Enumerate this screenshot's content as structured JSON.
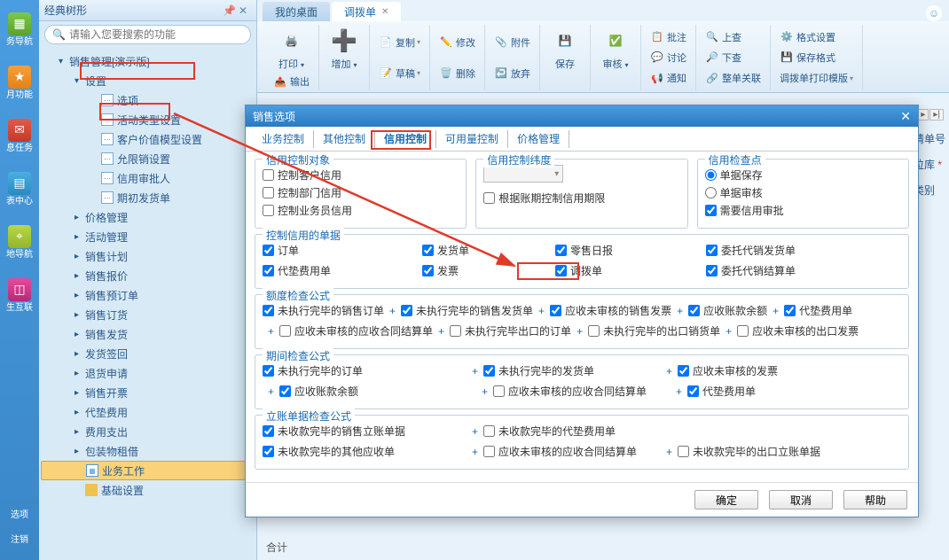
{
  "leftbar": {
    "items": [
      {
        "label": "务导航"
      },
      {
        "label": "月功能"
      },
      {
        "label": "息任务"
      },
      {
        "label": "表中心"
      },
      {
        "label": "地导航"
      },
      {
        "label": "生互联"
      }
    ],
    "bottom": [
      {
        "label": "选项"
      },
      {
        "label": "注销"
      }
    ]
  },
  "sidepanel": {
    "title": "经典树形",
    "search_placeholder": "请输入您要搜索的功能",
    "root": "销售管理[演示版]",
    "settings": "设置",
    "settings_children": [
      "选项",
      "活动类型设置",
      "客户价值模型设置",
      "允限销设置",
      "信用审批人",
      "期初发货单"
    ],
    "categories": [
      "价格管理",
      "活动管理",
      "销售计划",
      "销售报价",
      "销售预订单",
      "销售订货",
      "销售发货",
      "发货签回",
      "退货申请",
      "销售开票",
      "代垫费用",
      "费用支出",
      "包装物租借"
    ],
    "biz_work": "业务工作",
    "base_settings": "基础设置"
  },
  "tabs": {
    "desktop": "我的桌面",
    "active": "调拨单"
  },
  "toolbar": {
    "print": "打印",
    "output": "输出",
    "add": "增加",
    "copy": "复制",
    "draft": "草稿",
    "modify": "修改",
    "delete": "删除",
    "attach": "附件",
    "abandon": "放弃",
    "save": "保存",
    "audit": "审核",
    "batch_note": "批注",
    "discuss": "讨论",
    "notify": "通知",
    "up_check": "上查",
    "down_check": "下查",
    "doc_relation": "整单关联",
    "format": "格式设置",
    "save_format": "保存格式",
    "print_template": "调拨单打印模版"
  },
  "dialog": {
    "title": "销售选项",
    "tabs": [
      "业务控制",
      "其他控制",
      "信用控制",
      "可用量控制",
      "价格管理"
    ],
    "sec_obj": {
      "legend": "信用控制对象",
      "c1": "控制客户信用",
      "c2": "控制部门信用",
      "c3": "控制业务员信用"
    },
    "sec_dim": {
      "legend": "信用控制纬度",
      "c1": "根据账期控制信用期限"
    },
    "sec_chk": {
      "legend": "信用检查点",
      "r1": "单据保存",
      "r2": "单据审核",
      "c1": "需要信用审批"
    },
    "sec_docs": {
      "legend": "控制信用的单据",
      "c11": "订单",
      "c12": "发货单",
      "c13": "零售日报",
      "c14": "委托代销发货单",
      "c21": "代垫费用单",
      "c22": "发票",
      "c23": "调拨单",
      "c24": "委托代销结算单"
    },
    "sec_quota": {
      "legend": "额度检查公式",
      "c1": "未执行完毕的销售订单",
      "c2": "未执行完毕的销售发货单",
      "c3": "应收未审核的销售发票",
      "c4": "应收账款余额",
      "c5": "代垫费用单",
      "c6": "应收未审核的应收合同结算单",
      "c7": "未执行完毕出口的订单",
      "c8": "未执行完毕的出口销货单",
      "c9": "应收未审核的出口发票"
    },
    "sec_period": {
      "legend": "期间检查公式",
      "c1": "未执行完毕的订单",
      "c2": "未执行完毕的发货单",
      "c3": "应收未审核的发票",
      "c4": "应收账款余额",
      "c5": "应收未审核的应收合同结算单",
      "c6": "代垫费用单"
    },
    "sec_bill": {
      "legend": "立账单据检查公式",
      "c1": "未收款完毕的销售立账单据",
      "c2": "未收款完毕的代垫费用单",
      "c3": "未收款完毕的其他应收单",
      "c4": "应收未审核的应收合同结算单",
      "c5": "未收款完毕的出口立账单据"
    },
    "btn_ok": "确定",
    "btn_cancel": "取消",
    "btn_help": "帮助"
  },
  "rightedge": {
    "r1": "请单号",
    "r2": "位库",
    "r3": "类别"
  },
  "bottom_hint": "合计"
}
